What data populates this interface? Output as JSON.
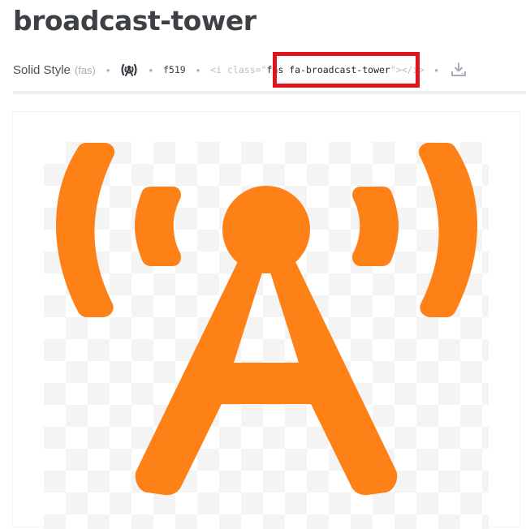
{
  "icon_page": {
    "title": "broadcast-tower",
    "style_label": "Solid Style",
    "style_prefix": "(fas)",
    "separator": "•",
    "unicode": "f519",
    "snippet_open": "<i class=\"",
    "snippet_class": "fas fa-broadcast-tower",
    "snippet_close": "\"></i>",
    "accent_color": "#fd8117",
    "highlight_color": "#e0141e",
    "icons": {
      "preview": "broadcast-tower-icon",
      "download": "download-icon"
    }
  }
}
